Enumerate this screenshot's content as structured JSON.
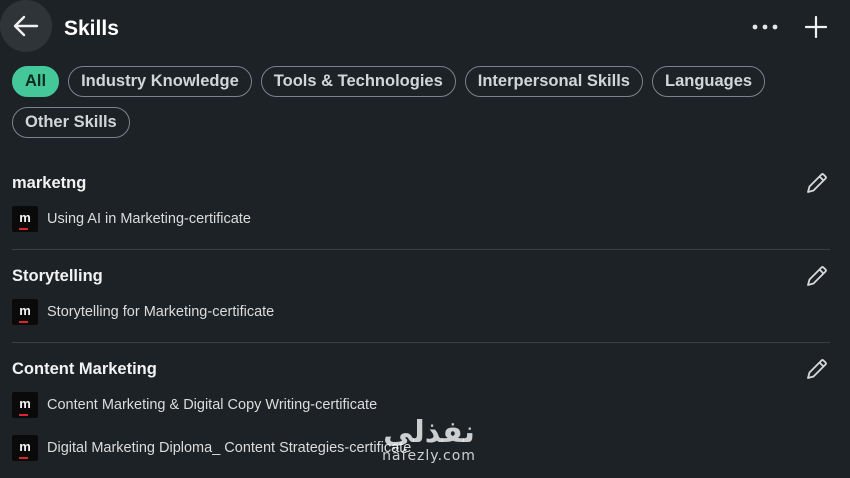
{
  "header": {
    "title": "Skills",
    "back_icon": "arrow-left-icon",
    "more_icon": "more-horizontal-icon",
    "add_icon": "plus-icon"
  },
  "filters": [
    {
      "label": "All",
      "active": true
    },
    {
      "label": "Industry Knowledge",
      "active": false
    },
    {
      "label": "Tools & Technologies",
      "active": false
    },
    {
      "label": "Interpersonal Skills",
      "active": false
    },
    {
      "label": "Languages",
      "active": false
    },
    {
      "label": "Other Skills",
      "active": false
    }
  ],
  "skills": [
    {
      "name": "marketng",
      "certificates": [
        "Using AI in Marketing-certificate"
      ]
    },
    {
      "name": "Storytelling",
      "certificates": [
        "Storytelling for Marketing-certificate"
      ]
    },
    {
      "name": "Content Marketing",
      "certificates": [
        "Content Marketing & Digital Copy Writing-certificate",
        "Digital Marketing Diploma_ Content Strategies-certificate"
      ]
    }
  ],
  "cert_logo_letter": "m",
  "watermark": {
    "arabic": "نفذلي",
    "latin": "nafezly.com"
  },
  "colors": {
    "background": "#1d2226",
    "accent": "#44c89a",
    "logo_red": "#d9262c"
  }
}
